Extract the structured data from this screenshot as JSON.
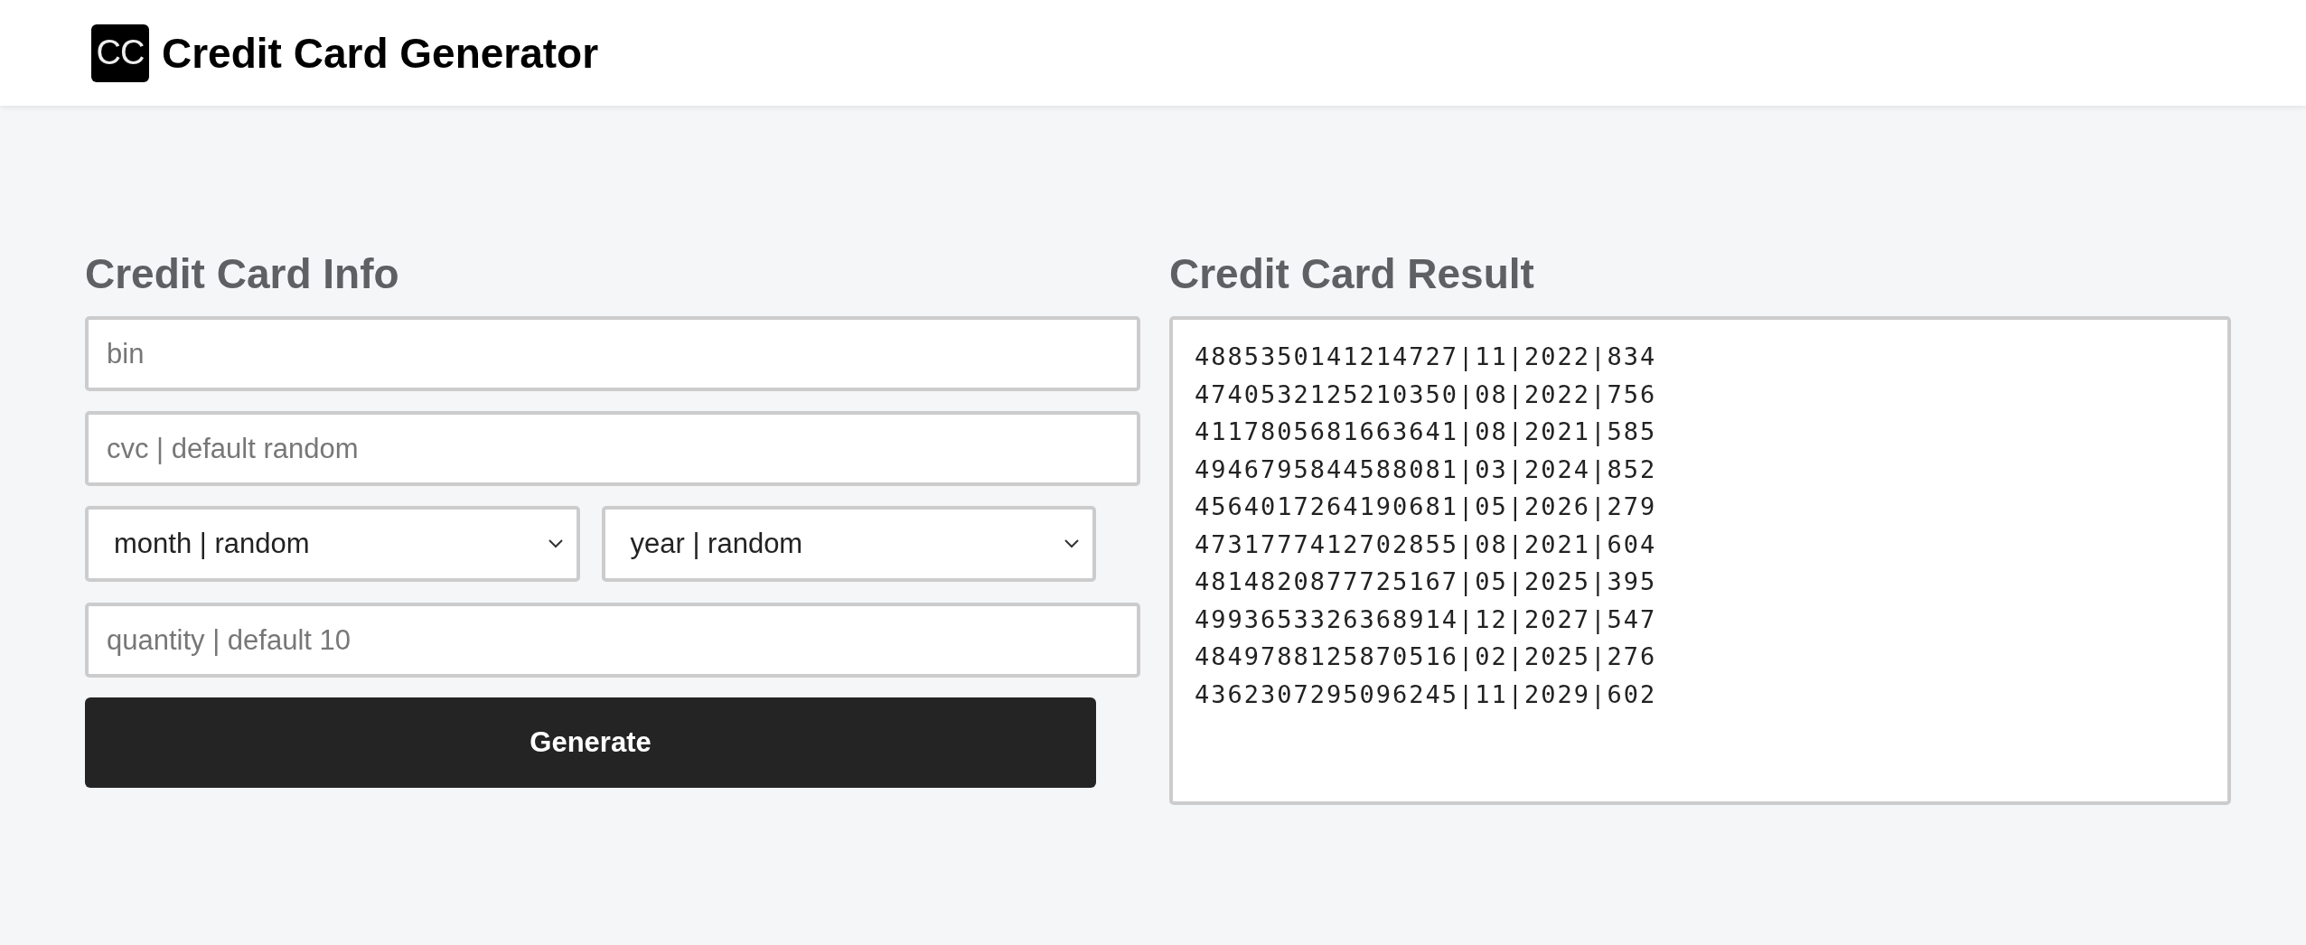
{
  "header": {
    "logo": "CC",
    "title": "Credit Card Generator"
  },
  "info": {
    "heading": "Credit Card Info",
    "fields": [
      {
        "kind": "input",
        "placeholder": "bin"
      },
      {
        "kind": "input",
        "placeholder": "cvc | default random"
      },
      {
        "kind": "selects",
        "options": [
          {
            "value": "month | random"
          },
          {
            "value": "year | random"
          }
        ]
      },
      {
        "kind": "input",
        "placeholder": "quantity | default 10"
      }
    ],
    "button": "Generate"
  },
  "result": {
    "heading": "Credit Card Result",
    "lines": [
      "4885350141214727|11|2022|834",
      "4740532125210350|08|2022|756",
      "4117805681663641|08|2021|585",
      "4946795844588081|03|2024|852",
      "4564017264190681|05|2026|279",
      "4731777412702855|08|2021|604",
      "4814820877725167|05|2025|395",
      "4993653326368914|12|2027|547",
      "4849788125870516|02|2025|276",
      "4362307295096245|11|2029|602"
    ]
  }
}
